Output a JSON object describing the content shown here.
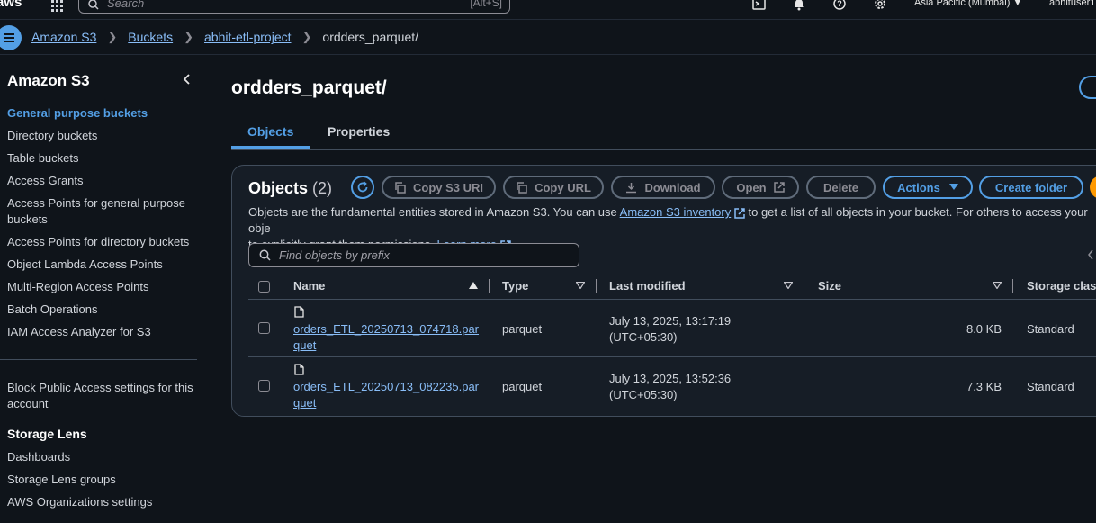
{
  "topnav": {
    "logo_text": "aws",
    "search_placeholder": "Search",
    "search_shortcut": "[Alt+S]",
    "region": "Asia Pacific (Mumbai) ▼",
    "user": "abhituser1"
  },
  "breadcrumb": {
    "items": [
      "Amazon S3",
      "Buckets",
      "abhit-etl-project"
    ],
    "current": "ordders_parquet/"
  },
  "sidebar": {
    "title": "Amazon S3",
    "items": [
      "General purpose buckets",
      "Directory buckets",
      "Table buckets",
      "Access Grants",
      "Access Points for general purpose buckets",
      "Access Points for directory buckets",
      "Object Lambda Access Points",
      "Multi-Region Access Points",
      "Batch Operations",
      "IAM Access Analyzer for S3"
    ],
    "block_public_access": "Block Public Access settings for this account",
    "storage_lens": {
      "heading": "Storage Lens",
      "items": [
        "Dashboards",
        "Storage Lens groups",
        "AWS Organizations settings"
      ]
    }
  },
  "main": {
    "title": "ordders_parquet/",
    "tabs": [
      "Objects",
      "Properties"
    ],
    "panel": {
      "title": "Objects",
      "count": "(2)",
      "buttons": {
        "copy_s3_uri": "Copy S3 URI",
        "copy_url": "Copy URL",
        "download": "Download",
        "open": "Open",
        "delete": "Delete",
        "actions": "Actions",
        "create_folder": "Create folder"
      },
      "description_1": "Objects are the fundamental entities stored in Amazon S3. You can use",
      "description_link_1": "Amazon S3 inventory",
      "description_2": "to get a list of all objects in your bucket. For others to access your obje",
      "description_3": "to explicitly grant them permissions.",
      "description_link_2": "Learn more",
      "filter_placeholder": "Find objects by prefix",
      "columns": [
        "Name",
        "Type",
        "Last modified",
        "Size",
        "Storage class"
      ],
      "rows": [
        {
          "name_1": "orders_ETL_20250713_074718.par",
          "name_2": "quet",
          "type": "parquet",
          "modified_1": "July 13, 2025, 13:17:19",
          "modified_2": "(UTC+05:30)",
          "size": "8.0 KB",
          "storage_class": "Standard"
        },
        {
          "name_1": "orders_ETL_20250713_082235.par",
          "name_2": "quet",
          "type": "parquet",
          "modified_1": "July 13, 2025, 13:52:36",
          "modified_2": "(UTC+05:30)",
          "size": "7.3 KB",
          "storage_class": "Standard"
        }
      ]
    }
  },
  "colors": {
    "background": "#0f141a",
    "panel": "#161d26",
    "accent": "#539fe5",
    "link": "#89bdf7",
    "orange": "#ff9900"
  }
}
